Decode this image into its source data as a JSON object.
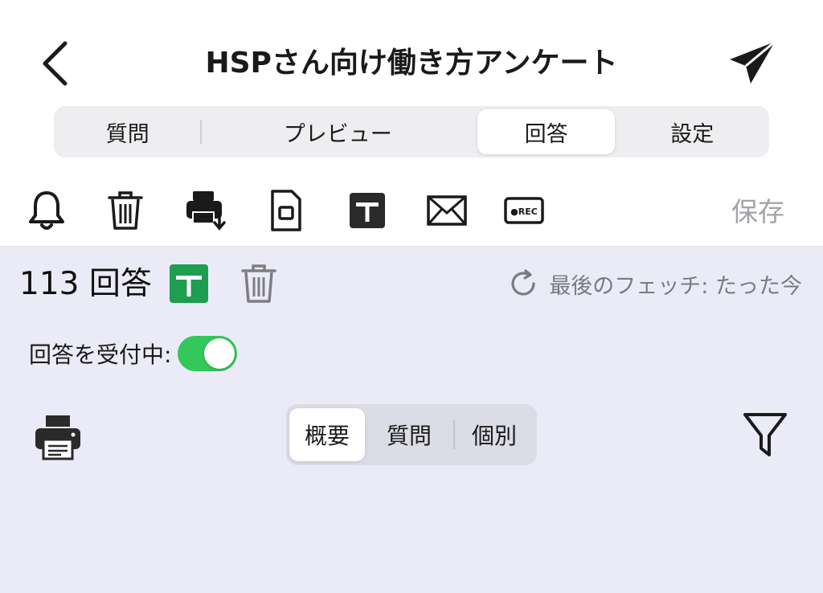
{
  "header": {
    "title": "HSPさん向け働き方アンケート"
  },
  "tabs": [
    {
      "label": "質問"
    },
    {
      "label": "プレビュー"
    },
    {
      "label": "回答",
      "active": true
    },
    {
      "label": "設定"
    }
  ],
  "toolbar": {
    "icons": [
      "bell-icon",
      "trash-icon",
      "print-download-icon",
      "document-icon",
      "sheet-icon",
      "mail-icon",
      "rec-icon"
    ],
    "rec_label": "●REC",
    "save_label": "保存"
  },
  "responses": {
    "count_label": "113 回答",
    "last_fetch": "最後のフェッチ: たった今",
    "accepting_label": "回答を受付中:",
    "accepting": true
  },
  "subtabs": [
    {
      "label": "概要",
      "active": true
    },
    {
      "label": "質問"
    },
    {
      "label": "個別"
    }
  ],
  "colors": {
    "accent_green": "#34c759",
    "sheet_green": "#1e9e50",
    "panel_bg": "#ebebf8",
    "save_disabled": "#a3a3a8"
  }
}
